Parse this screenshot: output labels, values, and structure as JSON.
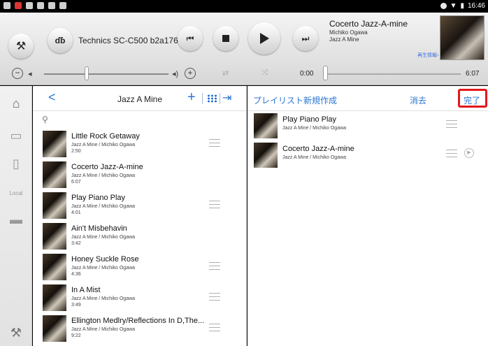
{
  "status_bar": {
    "time": "16:46"
  },
  "player": {
    "device_name": "Technics SC-C500 b2a176",
    "speaker_label": "ɗɓ",
    "now_playing": {
      "title": "Cocerto Jazz-A-mine",
      "artist": "Michiko Ogawa",
      "album": "Jazz A Mine",
      "info_link": "再生情報›"
    },
    "time_elapsed": "0:00",
    "time_total": "6:07",
    "volume_fraction": 0.34,
    "icons": {
      "settings": "wrench-icon",
      "prev": "skip-back-icon",
      "stop": "stop-icon",
      "play": "play-icon",
      "next": "skip-forward-icon",
      "repeat": "repeat-icon",
      "shuffle": "shuffle-icon",
      "volume": "speaker-icon"
    }
  },
  "left_nav": {
    "items": [
      "home-icon",
      "device-icon",
      "tablet-icon",
      "local-icon",
      "dock-icon"
    ],
    "local_label": "Local",
    "bottom": "wrench-icon"
  },
  "album_list": {
    "title": "Jazz A Mine",
    "back": "<",
    "plus": "+",
    "arrow": "|→",
    "tracks": [
      {
        "title": "Little Rock Getaway",
        "sub": "Jazz A Mine / Michiko Ogawa",
        "duration": "2:50"
      },
      {
        "title": "Cocerto Jazz-A-mine",
        "sub": "Jazz A Mine / Michiko Ogawa",
        "duration": "6:07"
      },
      {
        "title": "Play Piano Play",
        "sub": "Jazz A Mine / Michiko Ogawa",
        "duration": "4:01"
      },
      {
        "title": "Ain't Misbehavin",
        "sub": "Jazz A Mine / Michiko Ogawa",
        "duration": "3:42"
      },
      {
        "title": "Honey Suckle Rose",
        "sub": "Jazz A Mine / Michiko Ogawa",
        "duration": "4:36"
      },
      {
        "title": "In A Mist",
        "sub": "Jazz A Mine / Michiko Ogawa",
        "duration": "3:49"
      },
      {
        "title": "Ellington Medlry/Reflections In D,The...",
        "sub": "Jazz A Mine / Michiko Ogawa",
        "duration": "9:22"
      }
    ]
  },
  "playlist": {
    "new_label": "プレイリスト新規作成",
    "clear_label": "消去",
    "done_label": "完了",
    "highlight_color": "#e3171b",
    "items": [
      {
        "title": "Play Piano Play",
        "sub": "Jazz A Mine / Michiko Ogawa"
      },
      {
        "title": "Cocerto Jazz-A-mine",
        "sub": "Jazz A Mine / Michiko Ogawa"
      }
    ]
  }
}
